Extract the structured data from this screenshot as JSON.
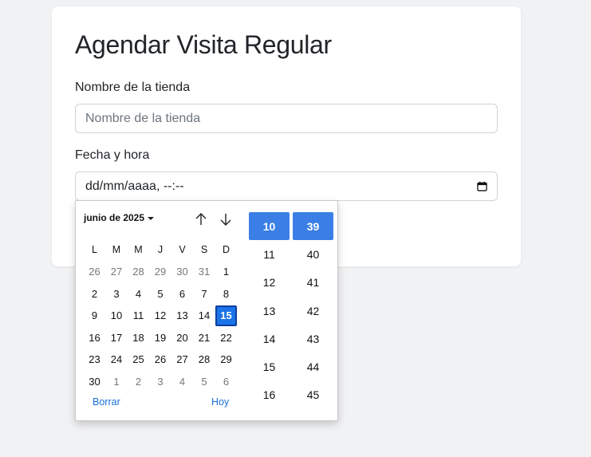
{
  "form": {
    "title": "Agendar Visita Regular",
    "store_label": "Nombre de la tienda",
    "store_placeholder": "Nombre de la tienda",
    "datetime_label": "Fecha y hora",
    "datetime_value": "dd/mm/aaaa, --:--"
  },
  "picker": {
    "month_label": "junio de 2025",
    "weekdays": [
      "L",
      "M",
      "M",
      "J",
      "V",
      "S",
      "D"
    ],
    "weeks": [
      [
        {
          "d": "26",
          "o": true
        },
        {
          "d": "27",
          "o": true
        },
        {
          "d": "28",
          "o": true
        },
        {
          "d": "29",
          "o": true
        },
        {
          "d": "30",
          "o": true
        },
        {
          "d": "31",
          "o": true
        },
        {
          "d": "1"
        }
      ],
      [
        {
          "d": "2"
        },
        {
          "d": "3"
        },
        {
          "d": "4"
        },
        {
          "d": "5"
        },
        {
          "d": "6"
        },
        {
          "d": "7"
        },
        {
          "d": "8"
        }
      ],
      [
        {
          "d": "9"
        },
        {
          "d": "10"
        },
        {
          "d": "11"
        },
        {
          "d": "12"
        },
        {
          "d": "13"
        },
        {
          "d": "14"
        },
        {
          "d": "15",
          "s": true
        }
      ],
      [
        {
          "d": "16"
        },
        {
          "d": "17"
        },
        {
          "d": "18"
        },
        {
          "d": "19"
        },
        {
          "d": "20"
        },
        {
          "d": "21"
        },
        {
          "d": "22"
        }
      ],
      [
        {
          "d": "23"
        },
        {
          "d": "24"
        },
        {
          "d": "25"
        },
        {
          "d": "26"
        },
        {
          "d": "27"
        },
        {
          "d": "28"
        },
        {
          "d": "29"
        }
      ],
      [
        {
          "d": "30"
        },
        {
          "d": "1",
          "o": true
        },
        {
          "d": "2",
          "o": true
        },
        {
          "d": "3",
          "o": true
        },
        {
          "d": "4",
          "o": true
        },
        {
          "d": "5",
          "o": true
        },
        {
          "d": "6",
          "o": true
        }
      ]
    ],
    "clear_label": "Borrar",
    "today_label": "Hoy",
    "hours": [
      "10",
      "11",
      "12",
      "13",
      "14",
      "15",
      "16"
    ],
    "minutes": [
      "39",
      "40",
      "41",
      "42",
      "43",
      "44",
      "45"
    ],
    "selected_hour": "10",
    "selected_minute": "39"
  },
  "colors": {
    "accent": "#1a73e8",
    "time_selected": "#3b7fe6",
    "link": "#1a6ed8"
  },
  "icons": {
    "datetime_field": "calendar-icon",
    "prev_month": "arrow-up-icon",
    "next_month": "arrow-down-icon"
  }
}
